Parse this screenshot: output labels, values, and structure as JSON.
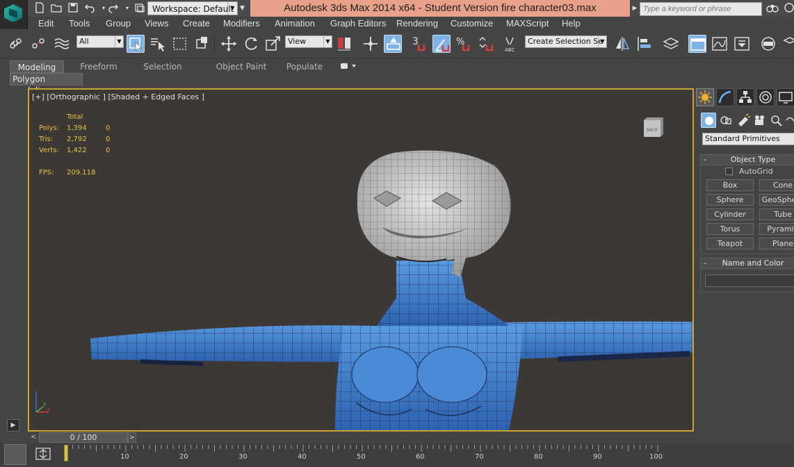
{
  "titlebar": {
    "workspace_label": "Workspace: Default",
    "title": "Autodesk 3ds Max  2014 x64  - Student Version    fire character03.max",
    "search_placeholder": "Type a keyword or phrase",
    "quick_access_icons": [
      "new-file-icon",
      "open-folder-icon",
      "save-icon",
      "undo-icon",
      "redo-icon",
      "project-folder-icon"
    ]
  },
  "menu": {
    "items": [
      "Edit",
      "Tools",
      "Group",
      "Views",
      "Create",
      "Modifiers",
      "Animation",
      "Graph Editors",
      "Rendering",
      "Customize",
      "MAXScript",
      "Help"
    ]
  },
  "toolbar": {
    "selection_filter": "All",
    "reference_coord": "View",
    "named_selection": "Create Selection Se",
    "snap_label": "3",
    "percent_label": "%"
  },
  "ribbon": {
    "tabs": [
      "Modeling",
      "Freeform",
      "Selection",
      "Object Paint",
      "Populate"
    ],
    "active_tab": "Modeling",
    "group_label": "Polygon Modeling"
  },
  "viewport": {
    "label": "[+] [Orthographic ] [Shaded + Edged Faces ]",
    "stats": {
      "header": "Total",
      "rows": [
        {
          "label": "Polys:",
          "total": "1,394",
          "sel": "0"
        },
        {
          "label": "Tris:",
          "total": "2,792",
          "sel": "0"
        },
        {
          "label": "Verts:",
          "total": "1,422",
          "sel": "0"
        }
      ],
      "fps_label": "FPS:",
      "fps_value": "209.118"
    },
    "viewcube_label": "BACK"
  },
  "command_panel": {
    "primitives_type": "Standard Primitives",
    "object_type_title": "Object Type",
    "autogrid_label": "AutoGrid",
    "primitives": [
      "Box",
      "Cone",
      "Sphere",
      "GeoSphere",
      "Cylinder",
      "Tube",
      "Torus",
      "Pyramid",
      "Teapot",
      "Plane"
    ],
    "name_color_title": "Name and Color"
  },
  "timeline": {
    "frame_display": "0 / 100",
    "ticks": [
      "10",
      "20",
      "30",
      "40",
      "50",
      "60",
      "70",
      "80",
      "90",
      "100"
    ]
  },
  "colors": {
    "viewport_border": "#c8a433",
    "stats_text": "#e6c43a",
    "active_button": "#7fb3e6",
    "title_bg": "#e8a088",
    "mesh_blue": "#3a78c8",
    "mesh_gray": "#bdbdbd"
  }
}
